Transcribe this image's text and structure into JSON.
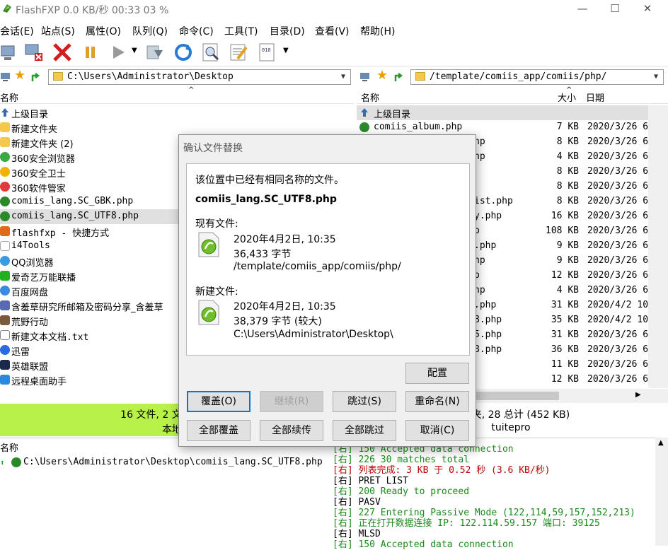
{
  "window": {
    "title": "FlashFXP 0.0 KB/秒 00:33 03 %"
  },
  "menu": [
    "会话(E)",
    "站点(S)",
    "属性(O)",
    "队列(Q)",
    "命令(C)",
    "工具(T)",
    "目录(D)",
    "查看(V)",
    "帮助(H)"
  ],
  "left_pane": {
    "path": "C:\\Users\\Administrator\\Desktop",
    "column_name": "名称",
    "items": [
      "上级目录",
      "新建文件夹",
      "新建文件夹 (2)",
      "360安全浏览器",
      "360安全卫士",
      "360软件管家",
      "comiis_lang.SC_GBK.php",
      "comiis_lang.SC_UTF8.php",
      "flashfxp - 快捷方式",
      "i4Tools",
      "QQ浏览器",
      "爱奇艺万能联播",
      "百度网盘",
      "含羞草研究所邮箱及密码分享_含羞草",
      "荒野行动",
      "新建文本文档.txt",
      "迅雷",
      "英雄联盟",
      "远程桌面助手"
    ],
    "status": "16 文件, 2 文件夹, 18 总",
    "status2": "本地浏"
  },
  "right_pane": {
    "path": "/template/comiis_app/comiis/php/",
    "columns": {
      "name": "名称",
      "size": "大小",
      "date": "日期"
    },
    "parent": "上级目录",
    "first_file": "comiis_album.php",
    "partials": [
      "hp",
      "hp",
      "",
      "",
      "ist.php",
      "y.php",
      "p",
      ".php",
      "hp",
      "p",
      "hp",
      ".php",
      "8.php",
      "5.php",
      "8.php",
      "",
      ""
    ],
    "sizes": [
      "7 KB",
      "8 KB",
      "4 KB",
      "8 KB",
      "8 KB",
      "8 KB",
      "16 KB",
      "108 KB",
      "9 KB",
      "9 KB",
      "12 KB",
      "4 KB",
      "31 KB",
      "35 KB",
      "31 KB",
      "36 KB",
      "11 KB",
      "12 KB"
    ],
    "dates": [
      "2020/3/26 6",
      "2020/3/26 6",
      "2020/3/26 6",
      "2020/3/26 6",
      "2020/3/26 6",
      "2020/3/26 6",
      "2020/3/26 6",
      "2020/3/26 6",
      "2020/3/26 6",
      "2020/3/26 6",
      "2020/3/26 6",
      "2020/3/26 6",
      "2020/4/2 10",
      "2020/4/2 10",
      "2020/3/26 6",
      "2020/3/26 6",
      "2020/3/26 6",
      "2020/3/26 6"
    ],
    "status": "文件夹, 28 总计 (452 KB)",
    "status2": "tuitepro"
  },
  "queue": {
    "column_name": "名称",
    "item": "C:\\Users\\Administrator\\Desktop\\comiis_lang.SC_UTF8.php"
  },
  "log": [
    {
      "tag": "[右]",
      "text": "150 Accepted data connection",
      "color": "green"
    },
    {
      "tag": "[右]",
      "text": "226 30 matches total",
      "color": "green"
    },
    {
      "tag": "[右]",
      "text": "列表完成: 3 KB 于 0.52 秒 (3.6 KB/秒)",
      "color": "red"
    },
    {
      "tag": "[右]",
      "text": "PRET LIST",
      "color": "blk"
    },
    {
      "tag": "[右]",
      "text": "200 Ready to proceed",
      "color": "green"
    },
    {
      "tag": "[右]",
      "text": "PASV",
      "color": "blk"
    },
    {
      "tag": "[右]",
      "text": "227 Entering Passive Mode (122,114,59,157,152,213)",
      "color": "green"
    },
    {
      "tag": "[右]",
      "text": "正在打开数据连接 IP: 122.114.59.157 端口: 39125",
      "color": "green"
    },
    {
      "tag": "[右]",
      "text": "MLSD",
      "color": "blk"
    },
    {
      "tag": "[右]",
      "text": "150 Accepted data connection",
      "color": "green"
    }
  ],
  "dialog": {
    "title": "确认文件替换",
    "message": "该位置中已经有相同名称的文件。",
    "filename": "comiis_lang.SC_UTF8.php",
    "existing_label": "现有文件:",
    "existing_date": "2020年4月2日, 10:35",
    "existing_size": "36,433 字节",
    "existing_path": "/template/comiis_app/comiis/php/",
    "new_label": "新建文件:",
    "new_date": "2020年4月2日, 10:35",
    "new_size": "38,379 字节 (较大)",
    "new_path": "C:\\Users\\Administrator\\Desktop\\",
    "buttons": {
      "config": "配置",
      "overwrite": "覆盖(O)",
      "resume": "继续(R)",
      "skip": "跳过(S)",
      "rename": "重命名(N)",
      "overwrite_all": "全部覆盖",
      "resume_all": "全部续传",
      "skip_all": "全部跳过",
      "cancel": "取消(C)"
    }
  },
  "colors": {
    "status_bar": "#b8f14a",
    "default_button": "#0078d7",
    "log_green": "#1a8a1a",
    "log_red": "#c00000"
  }
}
